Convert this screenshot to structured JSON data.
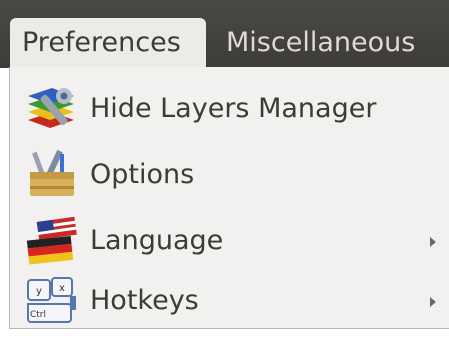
{
  "menubar": {
    "menus": [
      {
        "label": "Preferences"
      },
      {
        "label": "Miscellaneous"
      }
    ]
  },
  "menu": {
    "items": [
      {
        "label": "Hide Layers Manager",
        "icon": "layers-wrench-icon",
        "submenu": false
      },
      {
        "label": "Options",
        "icon": "toolbox-icon",
        "submenu": false
      },
      {
        "label": "Language",
        "icon": "flags-icon",
        "submenu": true
      },
      {
        "label": "Hotkeys",
        "icon": "keyboard-keys-icon",
        "submenu": true
      }
    ]
  }
}
